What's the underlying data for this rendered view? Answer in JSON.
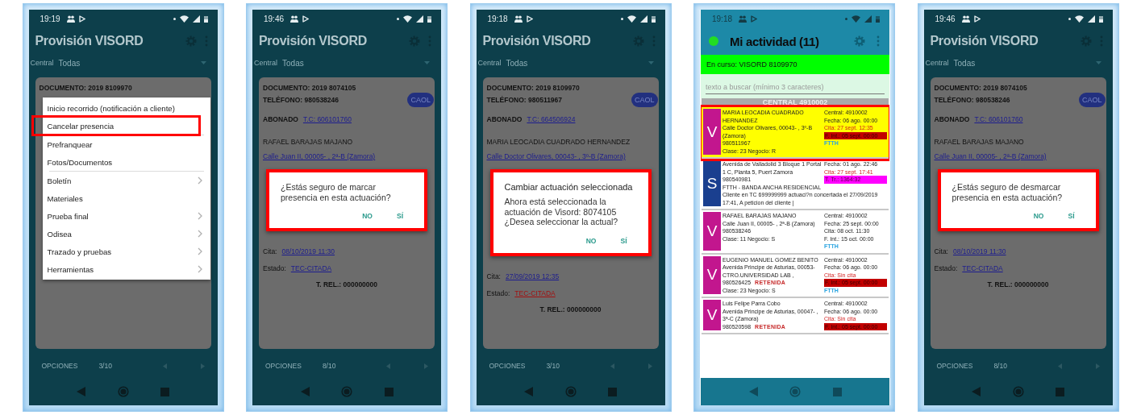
{
  "phones": [
    {
      "kind": "detail",
      "time": "19:19",
      "title": "Provisión VISORD",
      "filter": {
        "label": "Central",
        "value": "Todas"
      },
      "card": {
        "content": [
          {
            "kind": "heading",
            "text": "DOCUMENTO: 2019 8109970"
          },
          {
            "kind": "menu",
            "groups": [
              [
                {
                  "label": "Inicio recorrido (notificación a cliente)",
                  "submenu": false,
                  "highlighted": false
                },
                {
                  "label": "Cancelar presencia",
                  "submenu": false,
                  "highlighted": true
                }
              ],
              [
                {
                  "label": "Prefranquear",
                  "submenu": false,
                  "highlighted": false
                },
                {
                  "label": "Fotos/Documentos",
                  "submenu": false,
                  "highlighted": false
                }
              ],
              [
                {
                  "label": "Boletín",
                  "submenu": true,
                  "highlighted": false
                },
                {
                  "label": "Materiales",
                  "submenu": false,
                  "highlighted": false
                },
                {
                  "label": "Prueba final",
                  "submenu": true,
                  "highlighted": false
                },
                {
                  "label": "Odisea",
                  "submenu": true,
                  "highlighted": false
                },
                {
                  "label": "Trazado y pruebas",
                  "submenu": true,
                  "highlighted": false
                },
                {
                  "label": "Herramientas",
                  "submenu": true,
                  "highlighted": false
                }
              ]
            ]
          }
        ]
      },
      "footer": {
        "label": "OPCIONES",
        "page": "3/10"
      }
    },
    {
      "kind": "detail",
      "time": "19:46",
      "title": "Provisión VISORD",
      "filter": {
        "label": "Central",
        "value": "Todas"
      },
      "card": {
        "content": [
          {
            "kind": "heading",
            "text": "DOCUMENTO: 2019 8074105"
          },
          {
            "kind": "heading",
            "text": "TELÉFONO: 980538246",
            "badge": "CAOL"
          },
          {
            "kind": "strong_field",
            "label": "ABONADO",
            "link": "T.C: 606101760",
            "alert": false
          },
          {
            "kind": "text",
            "text": "RAFAEL BARAJAS MAJANO"
          },
          {
            "kind": "link",
            "text": "Calle  Juan II, 00005-  , 2ª-B (Zamora)"
          },
          {
            "kind": "dialog",
            "highlighted": true,
            "message": "¿Estás seguro de marcar presencia en esta actuación?",
            "buttons": [
              "NO",
              "SÍ"
            ]
          },
          {
            "kind": "field",
            "label": "Cita:",
            "link": "08/10/2019 11:30",
            "alert": false
          },
          {
            "kind": "field",
            "label": "Estado:",
            "link": "TEC-CITADA",
            "alert": false
          },
          {
            "kind": "footnote",
            "text": "T. REL.: 000000000"
          }
        ]
      },
      "footer": {
        "label": "OPCIONES",
        "page": "8/10"
      }
    },
    {
      "kind": "detail",
      "time": "19:18",
      "title": "Provisión VISORD",
      "filter": {
        "label": "Central",
        "value": "Todas"
      },
      "card": {
        "content": [
          {
            "kind": "heading",
            "text": "DOCUMENTO: 2019 8109970"
          },
          {
            "kind": "heading",
            "text": "TELÉFONO: 980511967",
            "badge": "CAOL"
          },
          {
            "kind": "strong_field",
            "label": "ABONADO",
            "link": "T.C: 664506924",
            "alert": false
          },
          {
            "kind": "text",
            "text": "MARIA LEOCADIA CUADRADO HERNANDEZ"
          },
          {
            "kind": "link",
            "text": "Calle  Doctor Olivares, 00043-  , 3º-B (Zamora)"
          },
          {
            "kind": "dialog",
            "highlighted": true,
            "title": "Cambiar actuación seleccionada",
            "message": "Ahora está seleccionada la actuación de Visord: 8074105 ¿Desea seleccionar la actual?",
            "buttons": [
              "NO",
              "SÍ"
            ]
          },
          {
            "kind": "field",
            "label": "Cita:",
            "link": "27/09/2019 12:35",
            "alert": false
          },
          {
            "kind": "field",
            "label": "Estado:",
            "link": "TEC-CITADA",
            "alert": true
          },
          {
            "kind": "footnote",
            "text": "T. REL.: 000000000"
          }
        ]
      },
      "footer": {
        "label": "OPCIONES",
        "page": "3/10"
      }
    },
    {
      "kind": "list",
      "time": "19:18",
      "title": "Mi actividad (11)",
      "banner": "En curso: VISORD 8109970",
      "search": {
        "placeholder": "texto a buscar (mínimo 3 caracteres)"
      },
      "section": "CENTRAL 4910002",
      "items": [
        {
          "letter": "V",
          "color": "#c2168e",
          "selected": true,
          "highlighted": true,
          "left": [
            {
              "text": "MARIA LEOCADIA CUADRADO HERNANDEZ"
            },
            {
              "text": "Calle  Doctor Olivares, 00043-  , 3º-B (Zamora)"
            },
            {
              "text": "980511967"
            },
            {
              "text": "Clase: 23 Negocio: R"
            }
          ],
          "right": [
            {
              "kind": "plain",
              "text": "Central: 4910002"
            },
            {
              "kind": "plain",
              "text": "Fecha: 06 ago. 00:00"
            },
            {
              "kind": "alert",
              "text": "Cita: 27 sept. 12:35"
            },
            {
              "kind": "flag",
              "text": "F. Int.: 05 sept. 00:00"
            },
            {
              "kind": "tech",
              "text": "FTTH"
            }
          ]
        },
        {
          "letter": "S",
          "color": "#1a3f8f",
          "selected": false,
          "highlighted": false,
          "left": [
            {
              "text": "Avenida de Valladolid 3 Bloque 1 Portal 1 C, Planta 5, Puert Zamora"
            },
            {
              "text": "980540981"
            },
            {
              "text": "FTTH - BANDA ANCHA RESIDENCIAL"
            }
          ],
          "right": [
            {
              "kind": "plain",
              "text": "Fecha: 01 ago. 22:46"
            },
            {
              "kind": "alert",
              "text": "Cita: 27 sept. 17:41"
            },
            {
              "kind": "timer",
              "text": "T. Tr.: 1364:32"
            }
          ],
          "note": "Cliente  en TC 699999999 actuaci?n concertada el 27/09/2019 17:41, A peticion del cliente |"
        },
        {
          "letter": "V",
          "color": "#c2168e",
          "selected": false,
          "highlighted": false,
          "left": [
            {
              "text": "RAFAEL BARAJAS MAJANO"
            },
            {
              "text": "Calle  Juan II, 00005-  , 2ª-B (Zamora)"
            },
            {
              "text": "980538246"
            },
            {
              "text": "Clase: 11 Negocio: S"
            }
          ],
          "right": [
            {
              "kind": "plain",
              "text": "Central: 4910002"
            },
            {
              "kind": "plain",
              "text": "Fecha: 25 sept. 00:00"
            },
            {
              "kind": "plain",
              "text": "Cita: 08 oct. 11:30"
            },
            {
              "kind": "plain",
              "text": "F. Int.: 15 oct. 00:00"
            },
            {
              "kind": "tech",
              "text": "FTTH"
            }
          ]
        },
        {
          "letter": "V",
          "color": "#c2168e",
          "selected": false,
          "highlighted": false,
          "left": [
            {
              "text": "EUGENIO MANUEL GOMEZ BENITO"
            },
            {
              "text": "Avenida  Principe de Asturias, 00053-CTRO.UNIVERSIDAD LAB  ,"
            },
            {
              "text": "980526425",
              "tag": "RETENIDA"
            },
            {
              "text": "Clase: 23 Negocio: S"
            }
          ],
          "right": [
            {
              "kind": "plain",
              "text": "Central: 4910002"
            },
            {
              "kind": "plain",
              "text": "Fecha: 06 ago. 00:00"
            },
            {
              "kind": "alert",
              "text": "Cita: Sin cita"
            },
            {
              "kind": "flag",
              "text": "F. Int.: 05 sept. 00:00"
            },
            {
              "kind": "tech",
              "text": "FTTH"
            }
          ]
        },
        {
          "letter": "V",
          "color": "#c2168e",
          "selected": false,
          "highlighted": false,
          "left": [
            {
              "text": "Luis Felipe Parra Cobo"
            },
            {
              "text": "Avenida  Principe de Asturias, 00047-  , 3ª-C (Zamora)"
            },
            {
              "text": "980520598",
              "tag": "RETENIDA"
            }
          ],
          "right": [
            {
              "kind": "plain",
              "text": "Central: 4910002"
            },
            {
              "kind": "plain",
              "text": "Fecha: 06 ago. 00:00"
            },
            {
              "kind": "alert",
              "text": "Cita: Sin cita"
            },
            {
              "kind": "flag",
              "text": "F. Int.: 05 sept. 00:00"
            }
          ]
        }
      ]
    },
    {
      "kind": "detail",
      "time": "19:46",
      "title": "Provisión VISORD",
      "filter": {
        "label": "Central",
        "value": "Todas"
      },
      "card": {
        "content": [
          {
            "kind": "heading",
            "text": "DOCUMENTO: 2019 8074105"
          },
          {
            "kind": "heading",
            "text": "TELÉFONO: 980538246",
            "badge": "CAOL"
          },
          {
            "kind": "strong_field",
            "label": "ABONADO",
            "link": "T.C: 606101760",
            "alert": false
          },
          {
            "kind": "text",
            "text": "RAFAEL BARAJAS MAJANO"
          },
          {
            "kind": "link",
            "text": "Calle  Juan II, 00005-  , 2ª-B (Zamora)"
          },
          {
            "kind": "dialog",
            "highlighted": true,
            "message": "¿Estás seguro de desmarcar presencia en esta actuación?",
            "buttons": [
              "NO",
              "SÍ"
            ]
          },
          {
            "kind": "field",
            "label": "Cita:",
            "link": "08/10/2019 11:30",
            "alert": false
          },
          {
            "kind": "field",
            "label": "Estado:",
            "link": "TEC-CITADA",
            "alert": false
          },
          {
            "kind": "footnote",
            "text": "T. REL.: 000000000"
          }
        ]
      },
      "footer": {
        "label": "OPCIONES",
        "page": "8/10"
      }
    }
  ]
}
